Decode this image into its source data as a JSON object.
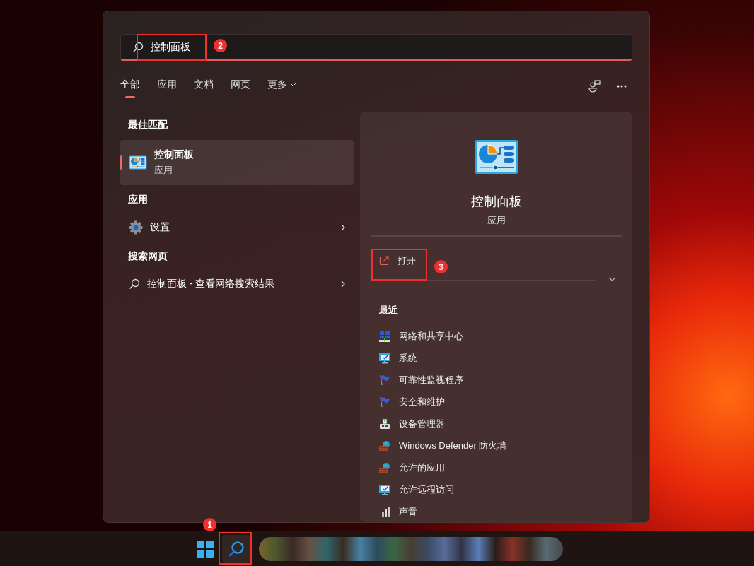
{
  "search": {
    "value": "控制面板"
  },
  "tabs": [
    {
      "label": "全部",
      "selected": true,
      "kind": "plain"
    },
    {
      "label": "应用",
      "selected": false,
      "kind": "plain"
    },
    {
      "label": "文档",
      "selected": false,
      "kind": "plain"
    },
    {
      "label": "网页",
      "selected": false,
      "kind": "plain"
    },
    {
      "label": "更多",
      "selected": false,
      "kind": "dropdown"
    }
  ],
  "best_match": {
    "heading": "最佳匹配",
    "title": "控制面板",
    "subtitle": "应用",
    "selected": true
  },
  "apps": {
    "heading": "应用",
    "items": [
      {
        "label": "设置"
      }
    ]
  },
  "web": {
    "heading": "搜索网页",
    "text": "控制面板 - 查看网络搜索结果"
  },
  "detail": {
    "title": "控制面板",
    "subtitle": "应用",
    "actions": [
      {
        "label": "打开"
      }
    ],
    "recent_heading": "最近",
    "recent": [
      {
        "label": "网络和共享中心",
        "kind": "network"
      },
      {
        "label": "系统",
        "kind": "monitor"
      },
      {
        "label": "可靠性监视程序",
        "kind": "flag"
      },
      {
        "label": "安全和维护",
        "kind": "flag"
      },
      {
        "label": "设备管理器",
        "kind": "device"
      },
      {
        "label": "Windows Defender 防火墙",
        "kind": "firewall"
      },
      {
        "label": "允许的应用",
        "kind": "firewall"
      },
      {
        "label": "允许远程访问",
        "kind": "monitor"
      },
      {
        "label": "声音",
        "kind": "sound"
      }
    ]
  },
  "annotations": [
    {
      "number": "1"
    },
    {
      "number": "2"
    },
    {
      "number": "3"
    }
  ]
}
